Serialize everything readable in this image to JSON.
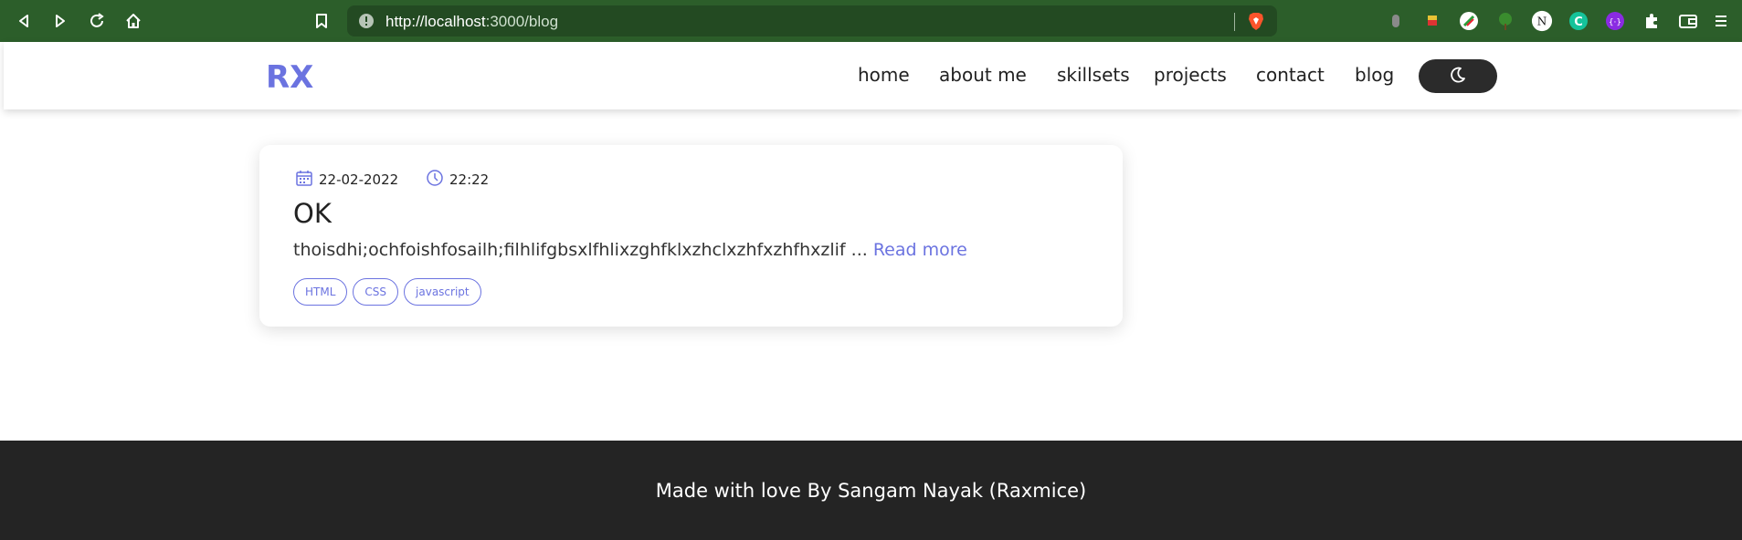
{
  "colors": {
    "chrome_bg": "#2c5e2a",
    "accent": "#6b73e0",
    "footer_bg": "#242424",
    "toggle_bg": "#2b2b2b"
  },
  "browser": {
    "url_host": "http://localhost",
    "url_path": ":3000/blog",
    "icons": [
      "back-icon",
      "forward-icon",
      "reload-icon",
      "home-icon",
      "bookmark-icon",
      "site-info-icon",
      "brave-shield-icon",
      "extensions-icon",
      "wallet-icon",
      "menu-icon"
    ]
  },
  "site": {
    "logo_text": "RX",
    "nav": [
      "home",
      "about me",
      "skillsets",
      "projects",
      "contact",
      "blog"
    ],
    "theme_toggle_icon": "moon-icon"
  },
  "post": {
    "date": "22-02-2022",
    "time": "22:22",
    "title": "OK",
    "excerpt": "thoisdhi;ochfoishfosailh;filhlifgbsxlfhlixzghfklxzhclxzhfxzhfhxzlif ...",
    "read_more": "Read more",
    "tags": [
      "HTML",
      "CSS",
      "javascript"
    ]
  },
  "footer": {
    "text": "Made with love By Sangam Nayak (Raxmice)"
  }
}
